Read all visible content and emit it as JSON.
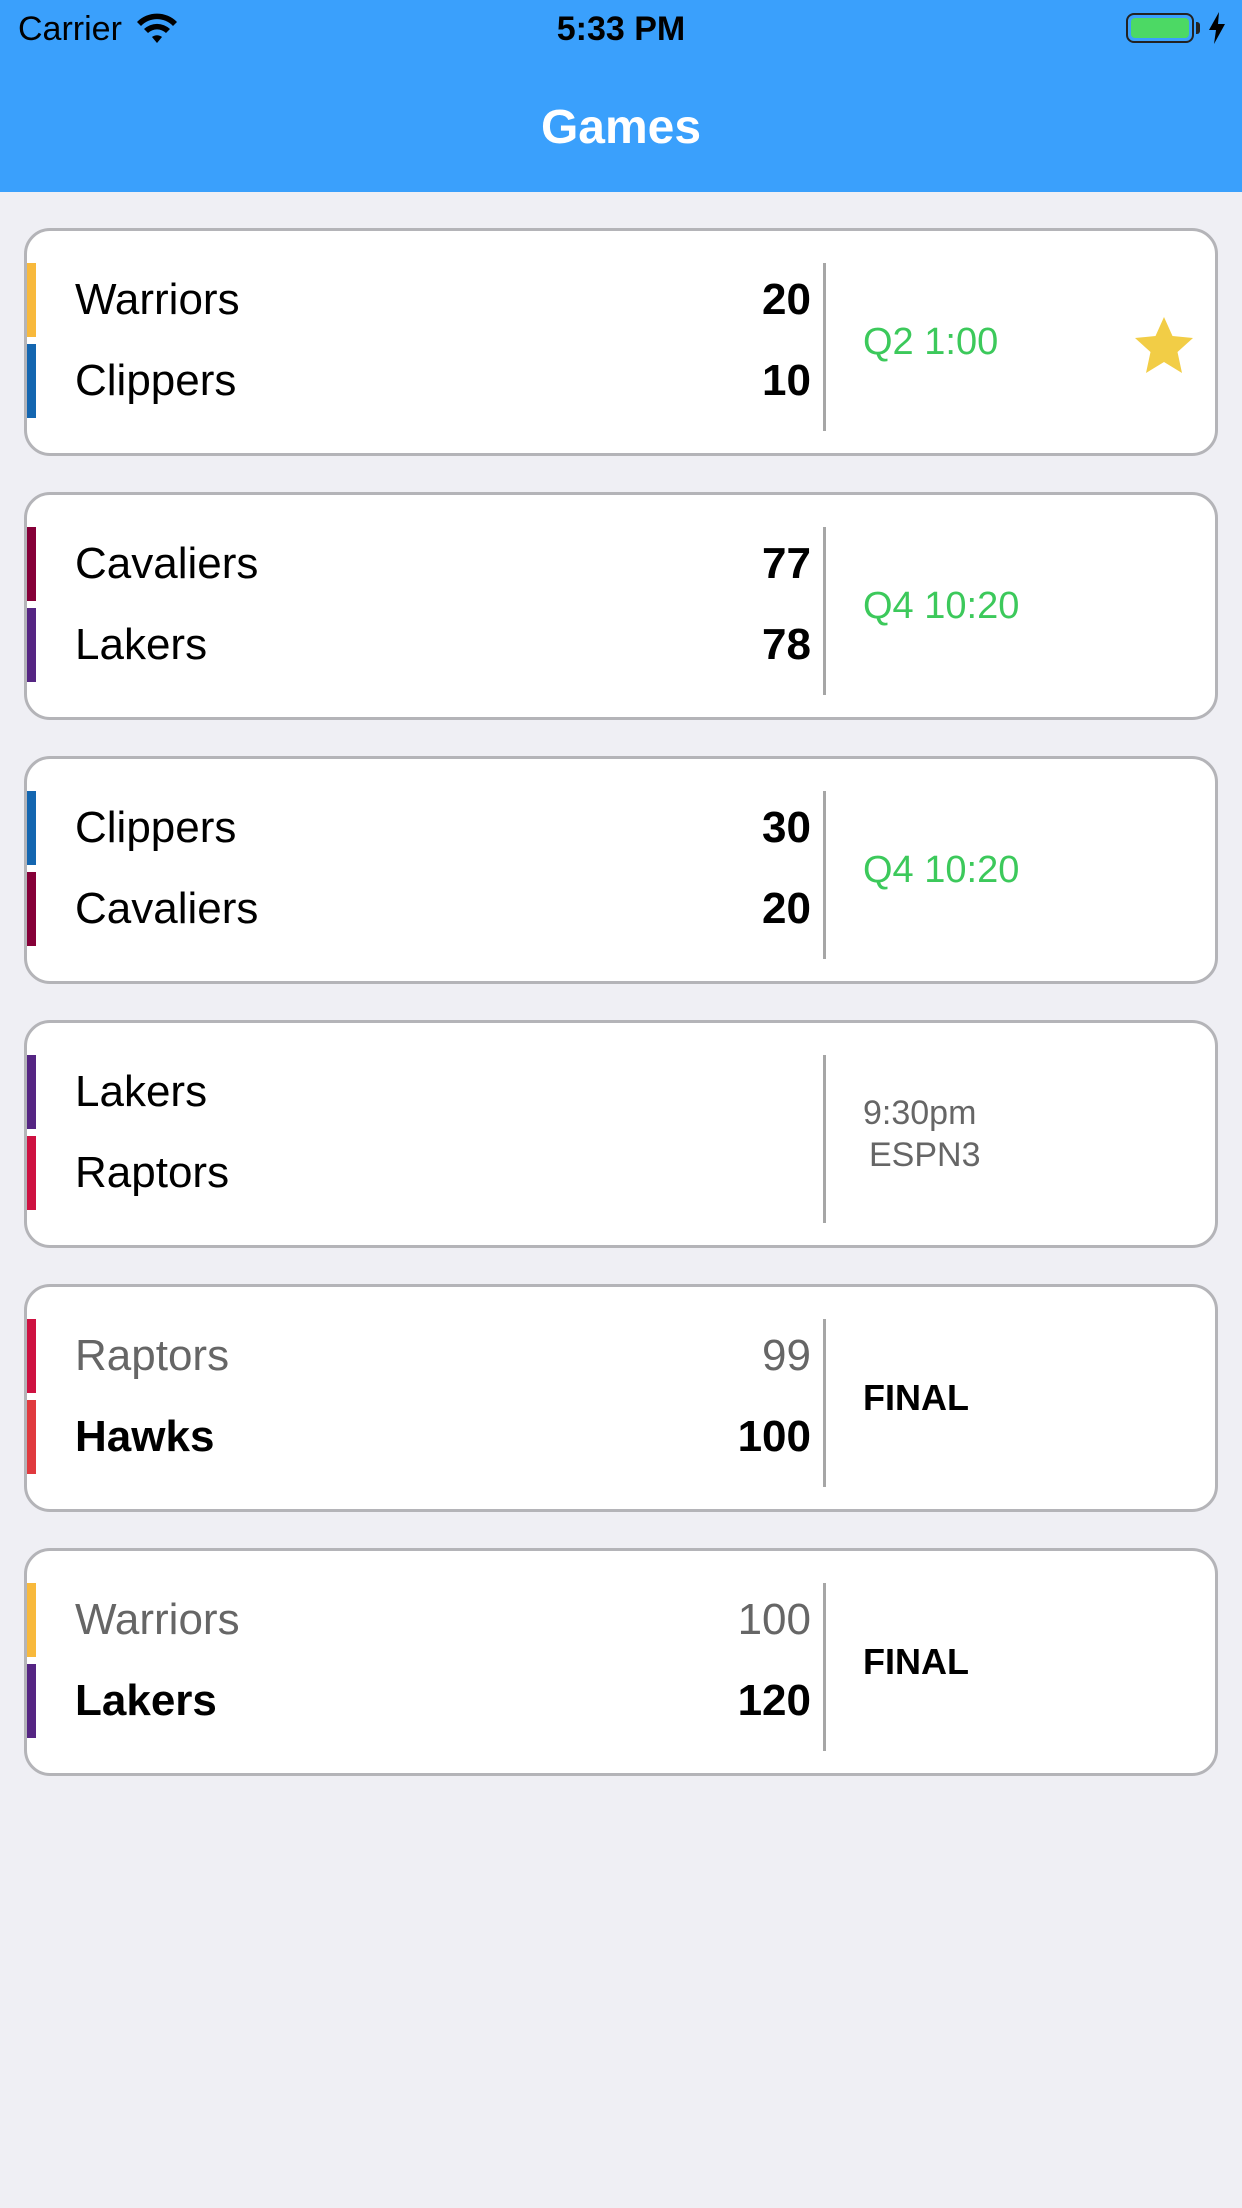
{
  "status_bar": {
    "carrier": "Carrier",
    "time": "5:33 PM",
    "battery_color": "#4cd964"
  },
  "nav": {
    "title": "Games",
    "bar_color": "#3aa0fc"
  },
  "colors": {
    "Warriors": "#f8b93c",
    "Clippers": "#1466b0",
    "Cavaliers": "#860038",
    "Lakers": "#552583",
    "Raptors": "#ce1141",
    "Hawks": "#e03a3e",
    "live_status": "#3cc95b",
    "favorite_star": "#f2cd46"
  },
  "games": [
    {
      "home": {
        "name": "Warriors",
        "score": "20"
      },
      "away": {
        "name": "Clippers",
        "score": "10"
      },
      "status": "Q2 1:00",
      "favorite": true
    },
    {
      "home": {
        "name": "Cavaliers",
        "score": "77"
      },
      "away": {
        "name": "Lakers",
        "score": "78"
      },
      "status": "Q4 10:20"
    },
    {
      "home": {
        "name": "Clippers",
        "score": "30"
      },
      "away": {
        "name": "Cavaliers",
        "score": "20"
      },
      "status": "Q4 10:20"
    },
    {
      "home": {
        "name": "Lakers"
      },
      "away": {
        "name": "Raptors"
      },
      "time": "9:30pm",
      "network": "ESPN3"
    },
    {
      "home": {
        "name": "Raptors",
        "score": "99"
      },
      "away": {
        "name": "Hawks",
        "score": "100"
      },
      "status": "FINAL"
    },
    {
      "home": {
        "name": "Warriors",
        "score": "100"
      },
      "away": {
        "name": "Lakers",
        "score": "120"
      },
      "status": "FINAL"
    }
  ]
}
